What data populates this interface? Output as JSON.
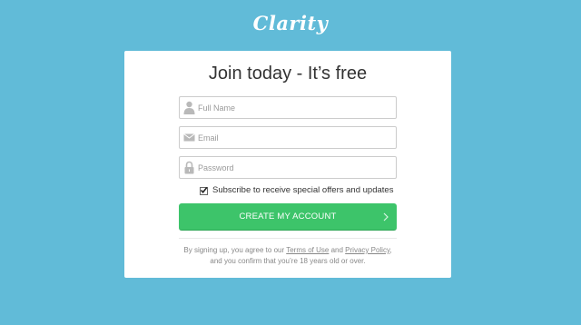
{
  "brand": {
    "logo_text": "Clarity"
  },
  "form": {
    "title": "Join today - It’s free",
    "full_name": {
      "placeholder": "Full Name",
      "value": ""
    },
    "email": {
      "placeholder": "Email",
      "value": ""
    },
    "password": {
      "placeholder": "Password",
      "value": ""
    },
    "subscribe": {
      "label": "Subscribe to receive special offers and updates",
      "checked": true
    },
    "submit_label": "CREATE MY ACCOUNT"
  },
  "legal": {
    "prefix": "By signing up, you agree to our",
    "terms_link": "Terms of Use",
    "and": "and",
    "privacy_link": "Privacy Policy",
    "suffix": ",",
    "line2": "and you confirm that you’re 18 years old or over."
  },
  "colors": {
    "background": "#61bbd8",
    "button": "#3dc46a",
    "card": "#ffffff"
  },
  "icons": {
    "full_name": "user-icon",
    "email": "envelope-icon",
    "password": "lock-icon",
    "checkbox": "checkmark-icon",
    "button_arrow": "chevron-right-icon"
  }
}
